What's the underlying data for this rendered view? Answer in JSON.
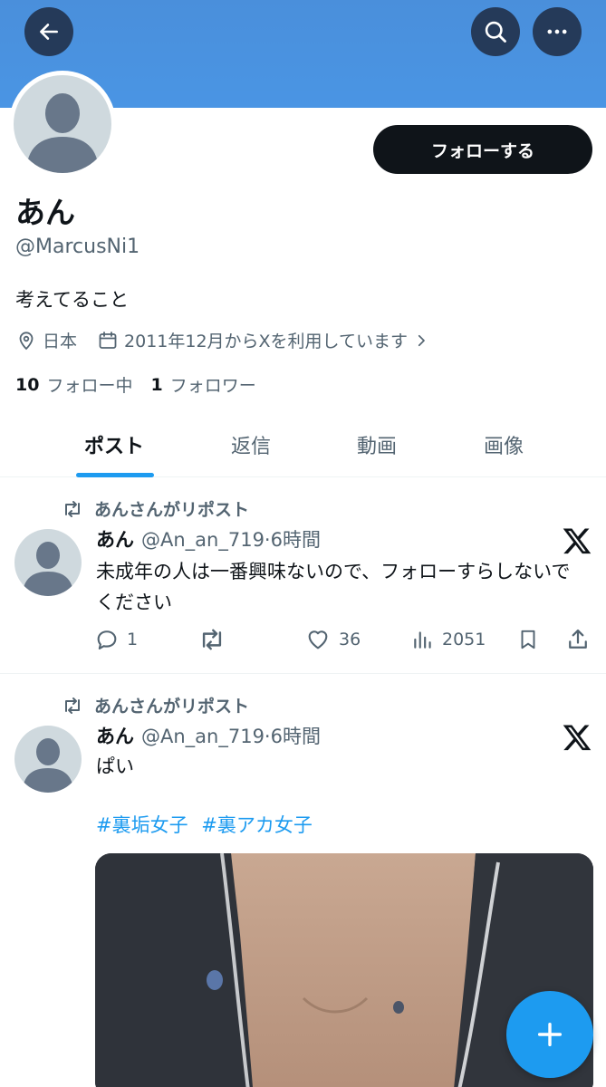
{
  "header": {
    "back_icon": "arrow-left-icon",
    "search_icon": "search-icon",
    "more_icon": "more-horizontal-icon",
    "banner_color": "#4a8fdb"
  },
  "profile": {
    "display_name": "あん",
    "handle": "@MarcusNi1",
    "bio": "考えてること",
    "follow_button": "フォローする",
    "location": "日本",
    "joined": "2011年12月からXを利用しています",
    "following_count": "10",
    "following_label": "フォロー中",
    "followers_count": "1",
    "followers_label": "フォロワー"
  },
  "tabs": [
    {
      "label": "ポスト",
      "active": true
    },
    {
      "label": "返信",
      "active": false
    },
    {
      "label": "動画",
      "active": false
    },
    {
      "label": "画像",
      "active": false
    }
  ],
  "posts": [
    {
      "repost_label": "あんさんがリポスト",
      "name": "あん",
      "meta": "@An_an_719·6時間",
      "text": "未成年の人は一番興味ないので、フォローすらしないでください",
      "replies": "1",
      "reposts": "",
      "likes": "36",
      "views": "2051"
    },
    {
      "repost_label": "あんさんがリポスト",
      "name": "あん",
      "meta": "@An_an_719·6時間",
      "text": "ぱい",
      "hashtags": [
        "#裏垢女子",
        "#裏アカ女子"
      ]
    }
  ],
  "colors": {
    "accent": "#1d9bf0",
    "text_primary": "#0f1419",
    "text_secondary": "#536471"
  }
}
